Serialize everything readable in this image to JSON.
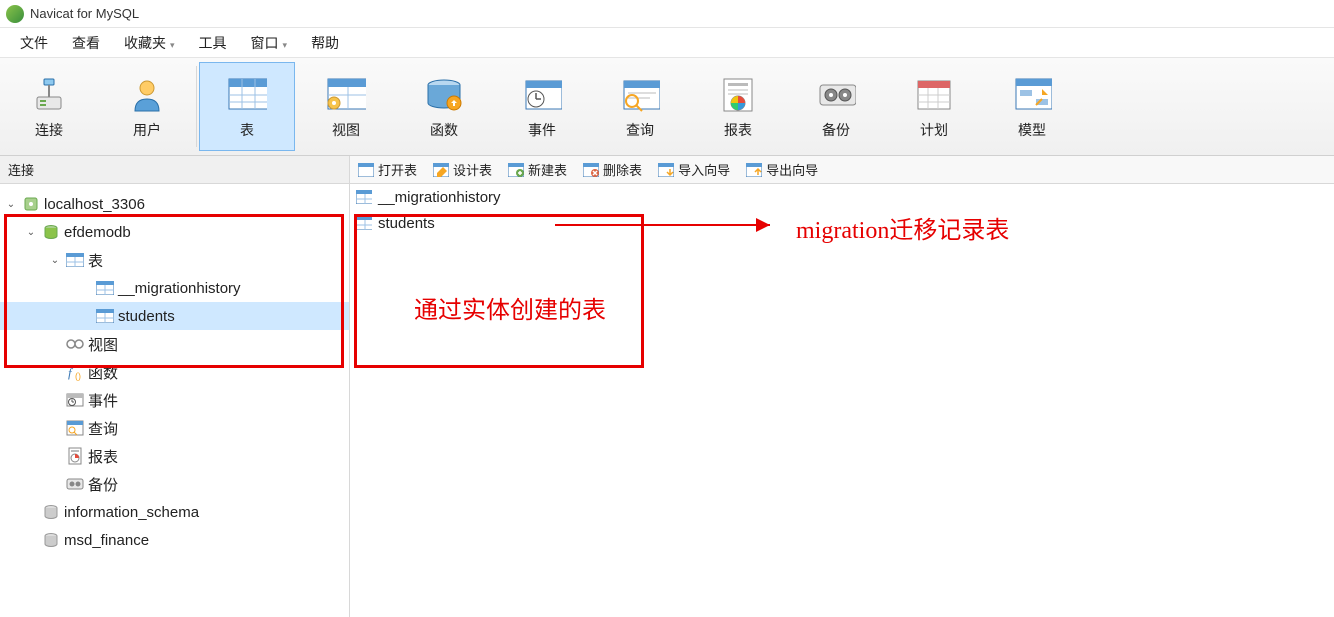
{
  "title": "Navicat for MySQL",
  "menu": [
    "文件",
    "查看",
    "收藏夹",
    "工具",
    "窗口",
    "帮助"
  ],
  "ribbon": [
    {
      "key": "connection",
      "label": "连接"
    },
    {
      "key": "user",
      "label": "用户"
    },
    {
      "key": "table",
      "label": "表",
      "active": true
    },
    {
      "key": "view",
      "label": "视图"
    },
    {
      "key": "function",
      "label": "函数"
    },
    {
      "key": "event",
      "label": "事件"
    },
    {
      "key": "query",
      "label": "查询"
    },
    {
      "key": "report",
      "label": "报表"
    },
    {
      "key": "backup",
      "label": "备份"
    },
    {
      "key": "schedule",
      "label": "计划"
    },
    {
      "key": "model",
      "label": "模型"
    }
  ],
  "sidebar_title": "连接",
  "toolbar_actions": [
    "打开表",
    "设计表",
    "新建表",
    "删除表",
    "导入向导",
    "导出向导"
  ],
  "tree": {
    "conn": "localhost_3306",
    "db": "efdemodb",
    "tables_label": "表",
    "tables": [
      "__migrationhistory",
      "students"
    ],
    "nodes": [
      {
        "key": "view",
        "label": "视图"
      },
      {
        "key": "function",
        "label": "函数"
      },
      {
        "key": "event",
        "label": "事件"
      },
      {
        "key": "query",
        "label": "查询"
      },
      {
        "key": "report",
        "label": "报表"
      },
      {
        "key": "backup",
        "label": "备份"
      }
    ],
    "other_dbs": [
      "information_schema",
      "msd_finance"
    ]
  },
  "main_items": [
    "__migrationhistory",
    "students"
  ],
  "annotations": {
    "right_label": "migration迁移记录表",
    "center_label": "通过实体创建的表"
  }
}
